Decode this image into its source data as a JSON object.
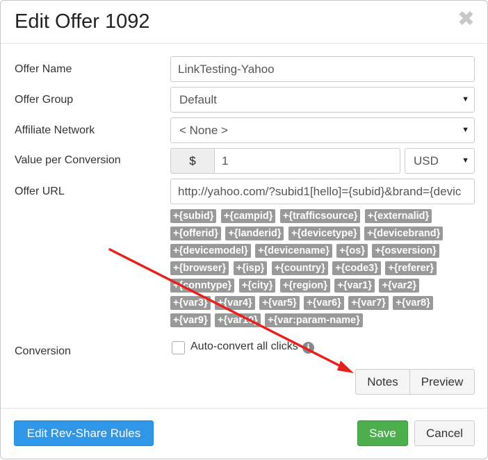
{
  "dialog": {
    "title": "Edit Offer 1092",
    "close_glyph": "✖"
  },
  "form": {
    "offer_name": {
      "label": "Offer Name",
      "value": "LinkTesting-Yahoo"
    },
    "offer_group": {
      "label": "Offer Group",
      "value": "Default"
    },
    "affiliate_network": {
      "label": "Affiliate Network",
      "value": "< None >"
    },
    "value_per_conversion": {
      "label": "Value per Conversion",
      "currency_symbol": "$",
      "value": "1",
      "currency": "USD"
    },
    "offer_url": {
      "label": "Offer URL",
      "value": "http://yahoo.com/?subid1[hello]={subid}&brand={devic"
    },
    "conversion": {
      "label": "Conversion",
      "checkbox_label": "Auto-convert all clicks",
      "checked": false,
      "info_glyph": "i"
    }
  },
  "tokens": [
    [
      "+{subid}",
      "+{campid}",
      "+{trafficsource}",
      "+{externalid}"
    ],
    [
      "+{offerid}",
      "+{landerid}",
      "+{devicetype}",
      "+{devicebrand}"
    ],
    [
      "+{devicemodel}",
      "+{devicename}",
      "+{os}",
      "+{osversion}"
    ],
    [
      "+{browser}",
      "+{isp}",
      "+{country}",
      "+{code3}",
      "+{referer}"
    ],
    [
      "+{conntype}",
      "+{city}",
      "+{region}",
      "+{var1}",
      "+{var2}"
    ],
    [
      "+{var3}",
      "+{var4}",
      "+{var5}",
      "+{var6}",
      "+{var7}",
      "+{var8}"
    ],
    [
      "+{var9}",
      "+{var10}",
      "+{var:param-name}"
    ]
  ],
  "url_actions": {
    "notes": "Notes",
    "preview": "Preview"
  },
  "footer": {
    "rev_share": "Edit Rev-Share Rules",
    "save": "Save",
    "cancel": "Cancel"
  },
  "colors": {
    "primary": "#2f96e8",
    "success": "#4cae4c",
    "token_bg": "#999999",
    "annotation_arrow": "#e8201c"
  },
  "icons": {
    "select_caret": "▼"
  }
}
